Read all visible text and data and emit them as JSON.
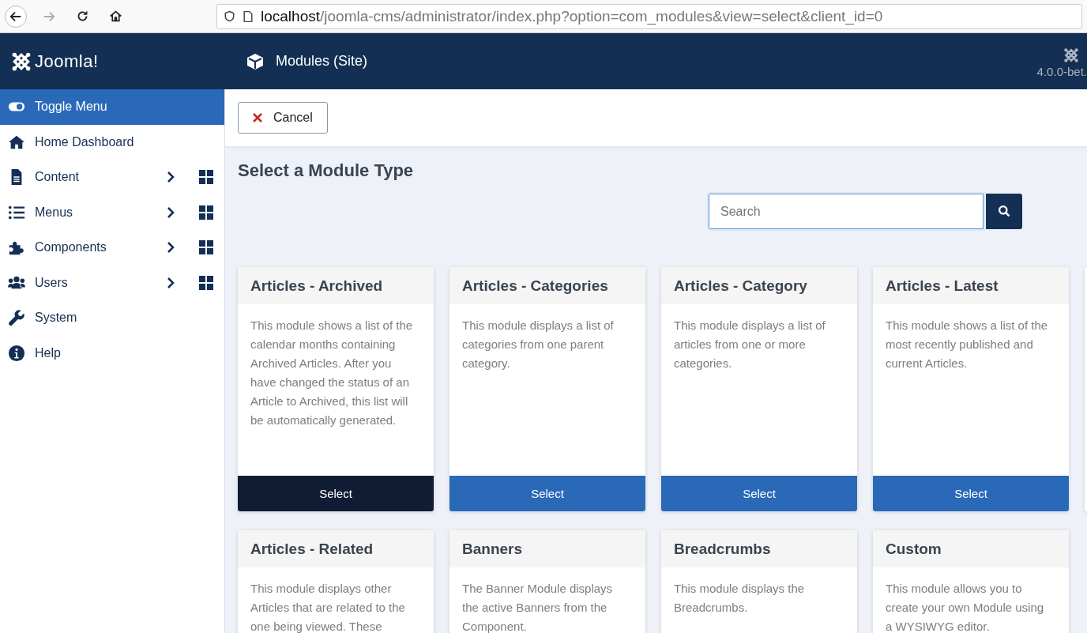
{
  "browser": {
    "url_host": "localhost",
    "url_path": "/joomla-cms/administrator/index.php?option=com_modules&view=select&client_id=0",
    "forward_disabled": true
  },
  "header": {
    "logo": "Joomla!",
    "title": "Modules (Site)",
    "version": "4.0.0-bet."
  },
  "sidebar": {
    "items": [
      {
        "kind": "toggle",
        "label": "Toggle Menu",
        "highlighted": true,
        "submenu": false
      },
      {
        "kind": "home",
        "label": "Home Dashboard",
        "highlighted": false,
        "submenu": false
      },
      {
        "kind": "file",
        "label": "Content",
        "highlighted": false,
        "submenu": true
      },
      {
        "kind": "list",
        "label": "Menus",
        "highlighted": false,
        "submenu": true
      },
      {
        "kind": "puzzle",
        "label": "Components",
        "highlighted": false,
        "submenu": true
      },
      {
        "kind": "users",
        "label": "Users",
        "highlighted": false,
        "submenu": true
      },
      {
        "kind": "wrench",
        "label": "System",
        "highlighted": false,
        "submenu": false
      },
      {
        "kind": "info",
        "label": "Help",
        "highlighted": false,
        "submenu": false
      }
    ]
  },
  "toolbar": {
    "cancel": "Cancel"
  },
  "heading": "Select a Module Type",
  "search": {
    "placeholder": "Search"
  },
  "modules": [
    {
      "title": "Articles - Archived",
      "description": "This module shows a list of the calendar months containing Archived Articles. After you have changed the status of an Article to Archived, this list will be automatically generated.",
      "button": "Select",
      "selected": true
    },
    {
      "title": "Articles - Categories",
      "description": "This module displays a list of categories from one parent category.",
      "button": "Select",
      "selected": false
    },
    {
      "title": "Articles - Category",
      "description": "This module displays a list of articles from one or more categories.",
      "button": "Select",
      "selected": false
    },
    {
      "title": "Articles - Latest",
      "description": "This module shows a list of the most recently published and current Articles.",
      "button": "Select",
      "selected": false
    },
    {
      "title": "Articles - Related",
      "description": "This module displays other Articles that are related to the one being viewed. These"
    },
    {
      "title": "Banners",
      "description": "The Banner Module displays the active Banners from the Component."
    },
    {
      "title": "Breadcrumbs",
      "description": "This module displays the Breadcrumbs."
    },
    {
      "title": "Custom",
      "description": "This module allows you to create your own Module using a WYSIWYG editor."
    }
  ]
}
